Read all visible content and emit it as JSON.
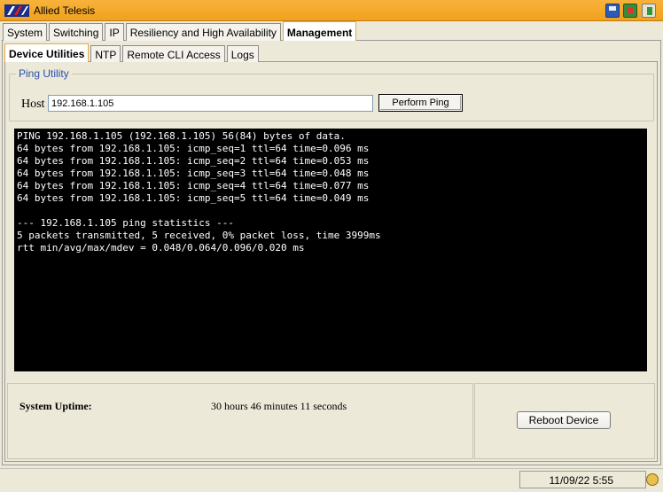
{
  "app": {
    "title": "Allied Telesis",
    "logo_text": "ATI"
  },
  "title_icons": [
    "save-icon",
    "network-icon",
    "exit-icon"
  ],
  "main_tabs": [
    {
      "label": "System"
    },
    {
      "label": "Switching"
    },
    {
      "label": "IP"
    },
    {
      "label": "Resiliency and High Availability"
    },
    {
      "label": "Management",
      "active": true
    }
  ],
  "sub_tabs": [
    {
      "label": "Device Utilities",
      "active": true
    },
    {
      "label": "NTP"
    },
    {
      "label": "Remote CLI Access"
    },
    {
      "label": "Logs"
    }
  ],
  "ping": {
    "group_title": "Ping Utility",
    "host_label": "Host",
    "host_value": "192.168.1.105",
    "button_label": "Perform Ping",
    "output": "PING 192.168.1.105 (192.168.1.105) 56(84) bytes of data.\n64 bytes from 192.168.1.105: icmp_seq=1 ttl=64 time=0.096 ms\n64 bytes from 192.168.1.105: icmp_seq=2 ttl=64 time=0.053 ms\n64 bytes from 192.168.1.105: icmp_seq=3 ttl=64 time=0.048 ms\n64 bytes from 192.168.1.105: icmp_seq=4 ttl=64 time=0.077 ms\n64 bytes from 192.168.1.105: icmp_seq=5 ttl=64 time=0.049 ms\n\n--- 192.168.1.105 ping statistics ---\n5 packets transmitted, 5 received, 0% packet loss, time 3999ms\nrtt min/avg/max/mdev = 0.048/0.064/0.096/0.020 ms"
  },
  "system": {
    "uptime_label": "System Uptime:",
    "uptime_value": "30 hours 46 minutes 11 seconds",
    "reboot_label": "Reboot Device"
  },
  "status": {
    "datetime": "11/09/22 5:55"
  },
  "colors": {
    "titlebar": "#f0a11e",
    "tab_active_border": "#e8a840",
    "group_title": "#2a4fb0",
    "console_bg": "#000000",
    "console_fg": "#ffffff"
  }
}
